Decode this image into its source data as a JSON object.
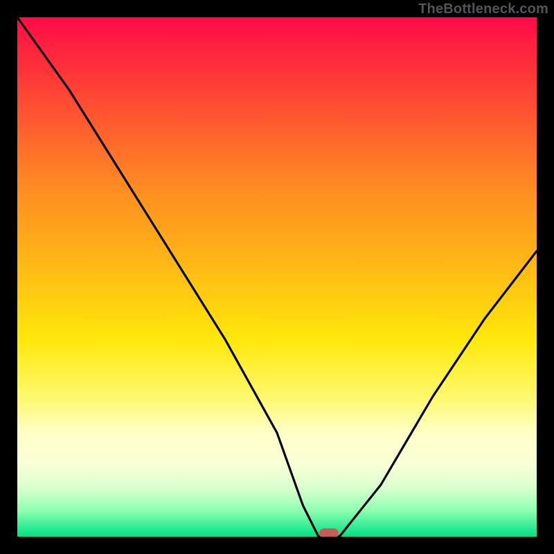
{
  "watermark": "TheBottleneck.com",
  "chart_data": {
    "type": "line",
    "title": "",
    "xlabel": "",
    "ylabel": "",
    "xlim": [
      0,
      100
    ],
    "ylim": [
      0,
      100
    ],
    "grid": false,
    "legend": false,
    "background": "rainbow-gradient (red top → yellow middle → green bottom)",
    "series": [
      {
        "name": "bottleneck-curve",
        "x": [
          0,
          10,
          20,
          30,
          40,
          50,
          55,
          58,
          62,
          70,
          80,
          90,
          100
        ],
        "y": [
          100,
          86,
          70,
          54,
          38,
          20,
          6,
          0,
          0,
          10,
          27,
          42,
          55
        ],
        "notes": "V-shaped curve; minimum (≈0) flat between x≈58 and x≈62"
      }
    ],
    "marker": {
      "x": 60,
      "y": 0,
      "color": "#c75a5a",
      "shape": "pill"
    }
  },
  "colors": {
    "frame": "#000000",
    "curve": "#000000",
    "marker": "#c75a5a",
    "watermark": "#555555"
  }
}
